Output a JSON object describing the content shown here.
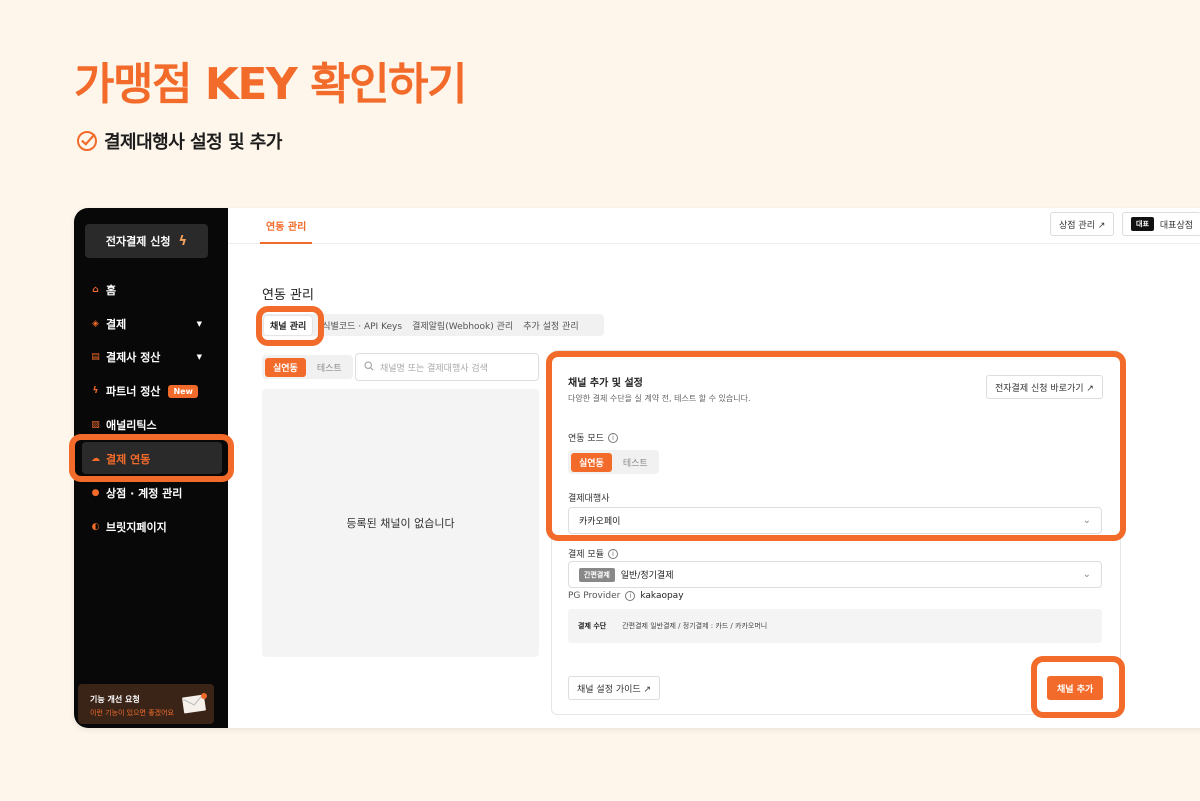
{
  "page": {
    "title": "가맹점 KEY 확인하기",
    "subtitle": "결제대행사 설정 및 추가"
  },
  "sidebar": {
    "apply_button": "전자결제 신청",
    "items": [
      {
        "label": "홈",
        "icon": "home-icon"
      },
      {
        "label": "결제",
        "icon": "layers-icon"
      },
      {
        "label": "결제사 정산",
        "icon": "document-icon"
      },
      {
        "label": "파트너 정산",
        "icon": "bolt-icon",
        "badge": "New"
      },
      {
        "label": "애널리틱스",
        "icon": "chart-icon"
      },
      {
        "label": "결제 연동",
        "icon": "link-icon"
      },
      {
        "label": "상점 · 계정 관리",
        "icon": "user-icon"
      },
      {
        "label": "브릿지페이지",
        "icon": "toggle-icon"
      }
    ],
    "feedback": {
      "title": "기능 개선 요청",
      "subtitle": "이런 기능이 있으면 좋겠어요"
    }
  },
  "topbar": {
    "tab": "연동 관리",
    "store_manage": "상점 관리 ↗",
    "rep_chip": "대표",
    "rep_store": "대표상점"
  },
  "main": {
    "section_title": "연동 관리",
    "sub_tabs": [
      "채널 관리",
      "식별코드 · API Keys",
      "결제알림(Webhook) 관리",
      "추가 설정 관리"
    ],
    "mode_live": "실연동",
    "mode_test": "테스트",
    "search_placeholder": "채널명 또는 결제대행사 검색",
    "empty_message": "등록된 채널이 없습니다"
  },
  "form": {
    "title": "채널 추가 및 설정",
    "description": "다양한 결제 수단을 실 계약 전, 테스트 할 수 있습니다.",
    "apply_link": "전자결제 신청 바로가기 ↗",
    "mode_label": "연동 모드",
    "mode_live": "실연동",
    "mode_test": "테스트",
    "pg_label": "결제대행사",
    "pg_value": "카카오페이",
    "module_label": "결제 모듈",
    "module_chip": "간편결제",
    "module_value": "일반/정기결제",
    "pg_provider_label": "PG Provider",
    "pg_provider_value": "kakaopay",
    "method_label": "결제 수단",
    "method_value": "간편결제 일반결제 / 정기결제 : 카드 / 카카오머니",
    "guide_button": "채널 설정 가이드 ↗",
    "add_button": "채널 추가"
  },
  "colors": {
    "accent": "#f26b2a",
    "background": "#fef6ea",
    "sidebar": "#080808"
  }
}
